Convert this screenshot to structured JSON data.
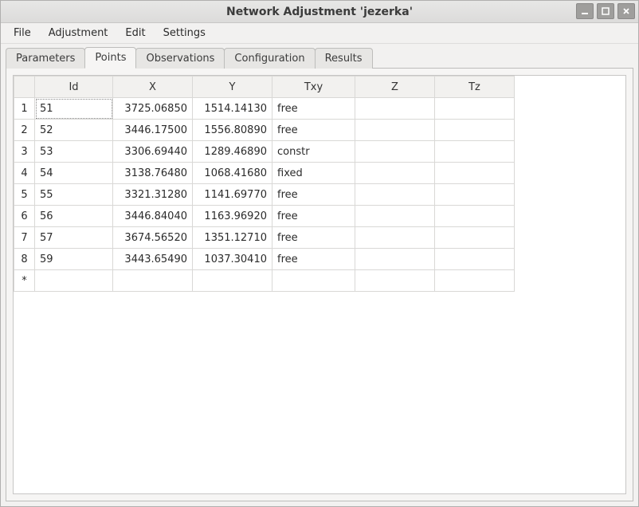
{
  "window": {
    "title": "Network Adjustment 'jezerka'"
  },
  "menubar": {
    "items": [
      "File",
      "Adjustment",
      "Edit",
      "Settings"
    ]
  },
  "tabs": {
    "items": [
      "Parameters",
      "Points",
      "Observations",
      "Configuration",
      "Results"
    ],
    "active_index": 1
  },
  "grid": {
    "headers": [
      "Id",
      "X",
      "Y",
      "Txy",
      "Z",
      "Tz"
    ],
    "new_row_marker": "*",
    "rows": [
      {
        "n": "1",
        "id": "51",
        "x": "3725.06850",
        "y": "1514.14130",
        "txy": "free",
        "z": "",
        "tz": ""
      },
      {
        "n": "2",
        "id": "52",
        "x": "3446.17500",
        "y": "1556.80890",
        "txy": "free",
        "z": "",
        "tz": ""
      },
      {
        "n": "3",
        "id": "53",
        "x": "3306.69440",
        "y": "1289.46890",
        "txy": "constr",
        "z": "",
        "tz": ""
      },
      {
        "n": "4",
        "id": "54",
        "x": "3138.76480",
        "y": "1068.41680",
        "txy": "fixed",
        "z": "",
        "tz": ""
      },
      {
        "n": "5",
        "id": "55",
        "x": "3321.31280",
        "y": "1141.69770",
        "txy": "free",
        "z": "",
        "tz": ""
      },
      {
        "n": "6",
        "id": "56",
        "x": "3446.84040",
        "y": "1163.96920",
        "txy": "free",
        "z": "",
        "tz": ""
      },
      {
        "n": "7",
        "id": "57",
        "x": "3674.56520",
        "y": "1351.12710",
        "txy": "free",
        "z": "",
        "tz": ""
      },
      {
        "n": "8",
        "id": "59",
        "x": "3443.65490",
        "y": "1037.30410",
        "txy": "free",
        "z": "",
        "tz": ""
      }
    ]
  }
}
